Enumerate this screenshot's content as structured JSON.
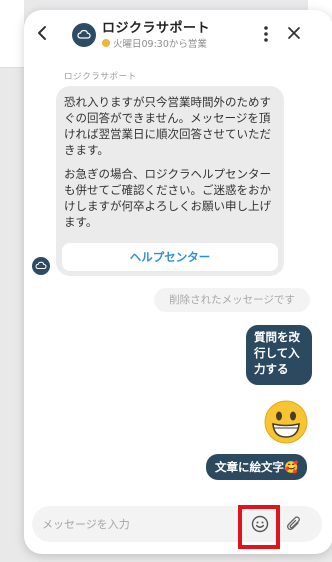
{
  "header": {
    "title": "ロジクラサポート",
    "status": "火曜日09:30から営業"
  },
  "messages": {
    "sender": "ロジクラサポート",
    "auto_reply_p1": "恐れ入りますが只今営業時間外のためすぐの回答ができません。メッセージを頂ければ翌営業日に順次回答させていただきます。",
    "auto_reply_p2": "お急ぎの場合、ロジクラヘルプセンターも併せてご確認ください。ご迷惑をおかけしますが何卒よろしくお願い申し上げます。",
    "help_button": "ヘルプセンター",
    "deleted": "削除されたメッセージです",
    "user_multiline": "質問を改行して入力する",
    "user_emoji_text": "文章に絵文字🥰"
  },
  "composer": {
    "placeholder": "メッセージを入力"
  },
  "icons": {
    "back": "chevron-left-icon",
    "menu": "kebab-menu-icon",
    "close": "close-icon",
    "emoji": "smiley-icon",
    "attach": "paperclip-icon"
  },
  "colors": {
    "brand": "#2c4a5f",
    "link": "#2f8fd6",
    "status_dot": "#f2b43b",
    "highlight": "#e0141e"
  }
}
